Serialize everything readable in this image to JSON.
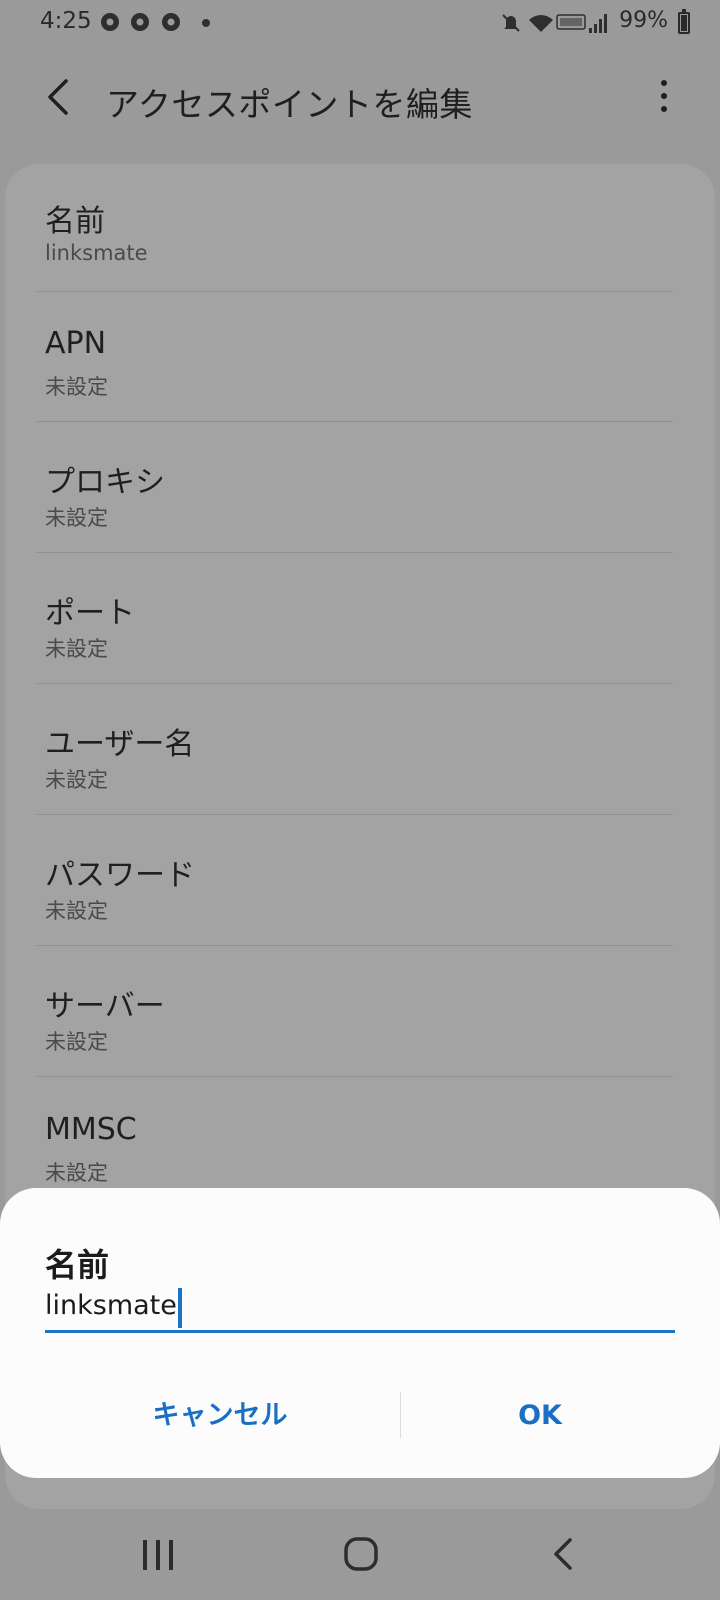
{
  "status_bar": {
    "time": "4:25",
    "battery": "99%",
    "battery_level": 0.99,
    "icons": [
      "chrome-icon",
      "chrome-icon",
      "chrome-icon",
      "notification-dot",
      "mute-icon",
      "wifi-icon",
      "volte-icon",
      "signal-icon",
      "battery-icon"
    ]
  },
  "header": {
    "title": "アクセスポイントを編集",
    "back_icon": "chevron-left-icon",
    "more_icon": "more-vertical-icon"
  },
  "settings": {
    "items": [
      {
        "title": "名前",
        "value": "linksmate"
      },
      {
        "title": "APN",
        "value": "未設定"
      },
      {
        "title": "プロキシ",
        "value": "未設定"
      },
      {
        "title": "ポート",
        "value": "未設定"
      },
      {
        "title": "ユーザー名",
        "value": "未設定"
      },
      {
        "title": "パスワード",
        "value": "未設定"
      },
      {
        "title": "サーバー",
        "value": "未設定"
      },
      {
        "title": "MMSC",
        "value": "未設定"
      }
    ]
  },
  "dialog": {
    "title": "名前",
    "input_value": "linksmate",
    "cancel_label": "キャンセル",
    "ok_label": "OK"
  },
  "nav_bar": {
    "icons": [
      "recents-icon",
      "home-icon",
      "back-icon"
    ]
  },
  "colors": {
    "accent": "#1a73c9",
    "dim_background": "#9a9a9a",
    "dialog_background": "#fcfcfc"
  }
}
